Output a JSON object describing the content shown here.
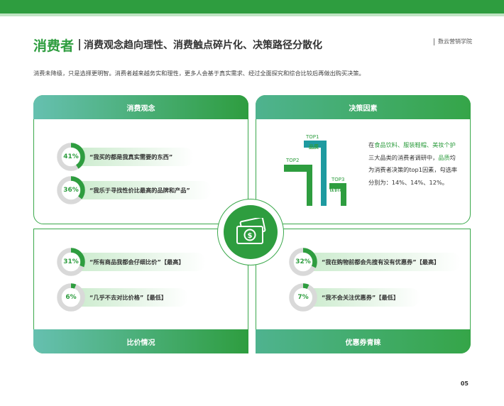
{
  "header": {
    "title": "消费者",
    "subtitle": "消费观念趋向理性、消费触点碎片化、决策路径分散化",
    "brand": "数云营销学院"
  },
  "intro": "消费未降级，只是选择更明智。消费者越来越务实和理性，更多人会基于真实需求、经过全面探究和综合比较后再做出购买决策。",
  "colors": {
    "accent": "#2e9d3f",
    "track": "#d9d9d9"
  },
  "panels": {
    "consumption_view": {
      "title": "消费观念",
      "items": [
        {
          "percent_label": "41%",
          "fraction": 0.41,
          "quote": "“我买的都是我真实需要的东西”"
        },
        {
          "percent_label": "36%",
          "fraction": 0.36,
          "quote": "“我乐于寻找性价比最高的品牌和产品”"
        }
      ]
    },
    "decision_factors": {
      "title": "决策因素",
      "ranks": [
        {
          "rank": "TOP1",
          "name": "品质"
        },
        {
          "rank": "TOP2",
          "name": "功能"
        },
        {
          "rank": "TOP3",
          "name": "性价比"
        }
      ],
      "text": {
        "p1": "在",
        "h1": "食品饮料、服装鞋帽、美妆个护",
        "p2": "三大品类的消费者调研中，",
        "h2": "品质",
        "p3": "均为消费者决策的top1因素，勾选率分别为：14%、14%、12%。"
      }
    },
    "price_compare": {
      "title": "比价情况",
      "items": [
        {
          "percent_label": "31%",
          "fraction": 0.31,
          "quote": "“所有商品我都会仔细比价”【最高】"
        },
        {
          "percent_label": "6%",
          "fraction": 0.06,
          "quote": "“几乎不去对比价格”【最低】"
        }
      ]
    },
    "coupon_preference": {
      "title": "优惠券青睐",
      "items": [
        {
          "percent_label": "32%",
          "fraction": 0.32,
          "quote": "“我在购物前都会先搜有没有优惠券”【最高】"
        },
        {
          "percent_label": "7%",
          "fraction": 0.07,
          "quote": "“我不会关注优惠券”【最低】"
        }
      ]
    }
  },
  "center_icon": "money-icon",
  "page_number": "05"
}
